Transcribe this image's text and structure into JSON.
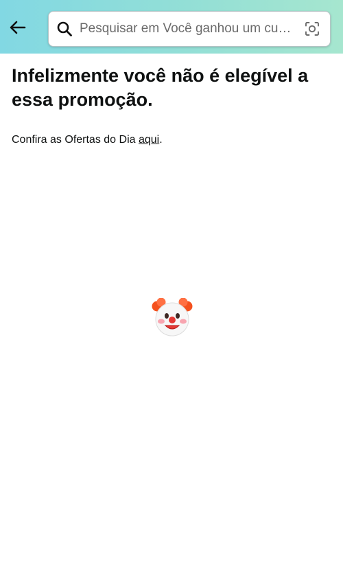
{
  "header": {
    "search": {
      "placeholder": "Pesquisar em Você ganhou um cu…"
    },
    "icons": {
      "back": "arrow-left-icon",
      "search": "magnifier-icon",
      "camera": "camera-lens-icon"
    },
    "colors": {
      "gradient_start": "#82d8e3",
      "gradient_end": "#a6e6cf"
    }
  },
  "main": {
    "headline": "Infelizmente você não é elegível a essa promoção.",
    "offers_prefix": "Confira as Ofertas do Dia ",
    "offers_link": "aqui",
    "offers_suffix": ".",
    "emoji": "clown-face"
  }
}
